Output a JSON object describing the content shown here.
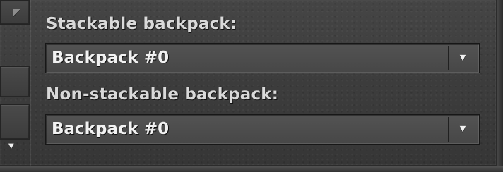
{
  "labels": {
    "stackable": "Stackable backpack:",
    "non_stackable": "Non-stackable backpack:"
  },
  "dropdowns": {
    "stackable_value": "Backpack #0",
    "non_stackable_value": "Backpack #0"
  },
  "icons": {
    "top_left": "checkbox-corner-icon",
    "left_mid": "chevron-down-icon",
    "dropdown_arrow": "chevron-down-icon"
  },
  "colors": {
    "panel_bg": "#414141",
    "text": "#d9d9d9",
    "dropdown_bg": "#4f4f4f"
  }
}
